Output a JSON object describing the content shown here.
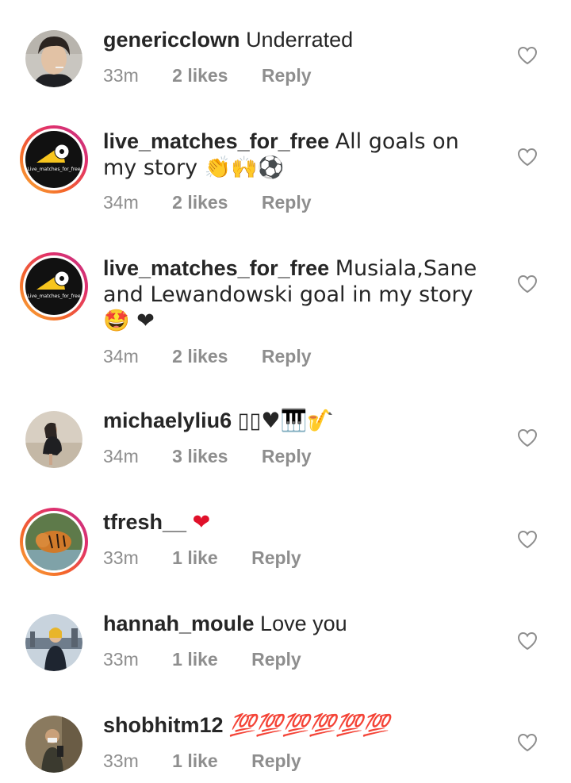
{
  "comments": [
    {
      "username": "genericclown",
      "text": "Underrated",
      "time": "33m",
      "likes": "2 likes",
      "reply": "Reply",
      "avatar": "profile-photo-young-man"
    },
    {
      "username": "live_matches_for_free",
      "text": "All goals on my story 👏🙌⚽",
      "time": "34m",
      "likes": "2 likes",
      "reply": "Reply",
      "avatar": "soccer-ball-logo",
      "avatar_text": "Live_matches_for_free"
    },
    {
      "username": "live_matches_for_free",
      "text": "Musiala,Sane and Lewandowski goal in my story 🤩 ❤",
      "time": "34m",
      "likes": "2 likes",
      "reply": "Reply",
      "avatar": "soccer-ball-logo",
      "avatar_text": "Live_matches_for_free"
    },
    {
      "username": "michaelyliu6",
      "text": "▯▯♥🎹🎷",
      "time": "34m",
      "likes": "3 likes",
      "reply": "Reply",
      "avatar": "profile-photo-woman-on-sofa"
    },
    {
      "username": "tfresh__",
      "text": "❤",
      "time": "33m",
      "likes": "1 like",
      "reply": "Reply",
      "avatar": "tiger-photo"
    },
    {
      "username": "hannah_moule",
      "text": "Love you",
      "time": "33m",
      "likes": "1 like",
      "reply": "Reply",
      "avatar": "profile-photo-woman-city"
    },
    {
      "username": "shobhitm12",
      "text": "💯💯💯💯💯💯",
      "time": "33m",
      "likes": "1 like",
      "reply": "Reply",
      "avatar": "profile-photo-mirror-selfie"
    }
  ],
  "colors": {
    "text": "#262626",
    "meta": "#8e8e8e",
    "story_ring_start": "#f9b13a",
    "story_ring_end": "#c13584"
  },
  "icons": {
    "like": "heart-outline-icon"
  }
}
